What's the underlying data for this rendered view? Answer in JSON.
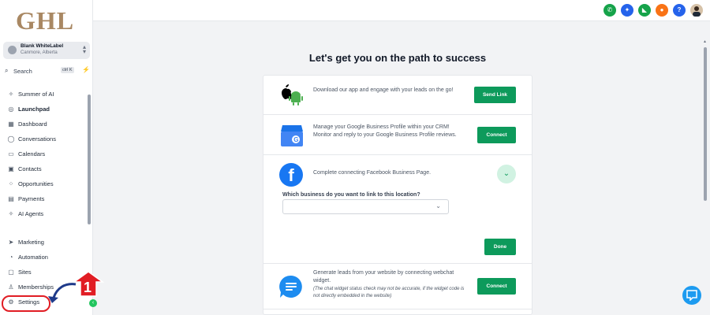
{
  "sidebar": {
    "logo": "GHL",
    "location": {
      "name": "Blank WhiteLabel",
      "sub": "Canmore, Alberta"
    },
    "search": {
      "label": "Search",
      "shortcut": "ctrl K"
    },
    "items": [
      {
        "label": "Summer of AI",
        "icon": "sparkle-icon"
      },
      {
        "label": "Launchpad",
        "icon": "rocket-icon",
        "active": true
      },
      {
        "label": "Dashboard",
        "icon": "grid-icon"
      },
      {
        "label": "Conversations",
        "icon": "chat-bubble-icon"
      },
      {
        "label": "Calendars",
        "icon": "calendar-icon"
      },
      {
        "label": "Contacts",
        "icon": "contact-card-icon"
      },
      {
        "label": "Opportunities",
        "icon": "funnel-icon"
      },
      {
        "label": "Payments",
        "icon": "receipt-icon"
      },
      {
        "label": "AI Agents",
        "icon": "sparkle-icon"
      }
    ],
    "items2": [
      {
        "label": "Marketing",
        "icon": "send-icon"
      },
      {
        "label": "Automation",
        "icon": "automation-icon"
      },
      {
        "label": "Sites",
        "icon": "globe-icon"
      },
      {
        "label": "Memberships",
        "icon": "membership-icon"
      },
      {
        "label": "Settings",
        "icon": "gear-icon"
      }
    ]
  },
  "topbar": {
    "icons": [
      {
        "name": "phone-icon",
        "color": "#16a34a",
        "glyph": "✆"
      },
      {
        "name": "magic-icon",
        "color": "#2563eb",
        "glyph": "✦"
      },
      {
        "name": "megaphone-icon",
        "color": "#16a34a",
        "glyph": "◣"
      },
      {
        "name": "bell-icon",
        "color": "#f97316",
        "glyph": "●"
      },
      {
        "name": "help-icon",
        "color": "#2563eb",
        "glyph": "?"
      }
    ]
  },
  "main": {
    "headline": "Let's get you on the path to success",
    "app_row": {
      "text": "Download our app and engage with your leads on the go!",
      "button": "Send Link"
    },
    "google_row": {
      "text": "Manage your Google Business Profile within your CRM! Monitor and reply to your Google Business Profile reviews.",
      "button": "Connect"
    },
    "facebook_row": {
      "text": "Complete connecting Facebook Business Page.",
      "select_label": "Which business do you want to link to this location?",
      "select_value": "",
      "button": "Done"
    },
    "webchat_row": {
      "text": "Generate leads from your website by connecting webchat widget.",
      "note": "(The chat widget status check may not be accurate, if the widget code is not directly embedded in the website)",
      "button": "Connect"
    }
  },
  "annotation": {
    "step": "1"
  },
  "colors": {
    "accent_green": "#0d9a5b",
    "logo_gold": "#a98863",
    "highlight_red": "#e11d24",
    "facebook_blue": "#1877f2"
  }
}
